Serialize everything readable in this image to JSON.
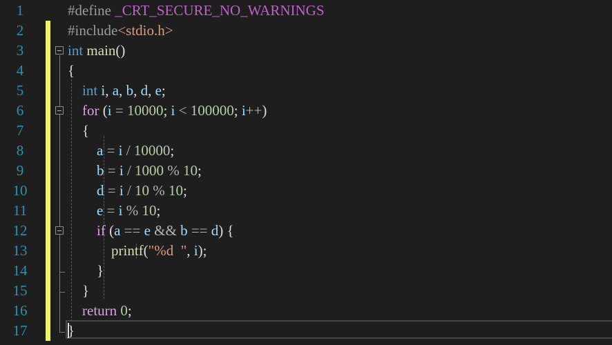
{
  "editor": {
    "line_numbers": [
      "1",
      "2",
      "3",
      "4",
      "5",
      "6",
      "7",
      "8",
      "9",
      "10",
      "11",
      "12",
      "13",
      "14",
      "15",
      "16",
      "17"
    ],
    "lines": [
      [
        {
          "t": "#define ",
          "c": "pp"
        },
        {
          "t": "_CRT_SECURE_NO_WARNINGS",
          "c": "macro"
        }
      ],
      [
        {
          "t": "#include",
          "c": "pp"
        },
        {
          "t": "<stdio.h>",
          "c": "str"
        }
      ],
      [
        {
          "t": "int",
          "c": "kw"
        },
        {
          "t": " ",
          "c": "pl"
        },
        {
          "t": "main",
          "c": "fn"
        },
        {
          "t": "()",
          "c": "pl"
        }
      ],
      [
        {
          "t": "{",
          "c": "pl"
        }
      ],
      [
        {
          "t": "    ",
          "c": "pl"
        },
        {
          "t": "int",
          "c": "kw"
        },
        {
          "t": " ",
          "c": "pl"
        },
        {
          "t": "i",
          "c": "var"
        },
        {
          "t": ", ",
          "c": "pl"
        },
        {
          "t": "a",
          "c": "var"
        },
        {
          "t": ", ",
          "c": "pl"
        },
        {
          "t": "b",
          "c": "var"
        },
        {
          "t": ", ",
          "c": "pl"
        },
        {
          "t": "d",
          "c": "var"
        },
        {
          "t": ", ",
          "c": "pl"
        },
        {
          "t": "e",
          "c": "var"
        },
        {
          "t": ";",
          "c": "pl"
        }
      ],
      [
        {
          "t": "    ",
          "c": "pl"
        },
        {
          "t": "for",
          "c": "kw2"
        },
        {
          "t": " (",
          "c": "pl"
        },
        {
          "t": "i",
          "c": "var"
        },
        {
          "t": " = ",
          "c": "op"
        },
        {
          "t": "10000",
          "c": "num"
        },
        {
          "t": "; ",
          "c": "pl"
        },
        {
          "t": "i",
          "c": "var"
        },
        {
          "t": " < ",
          "c": "op"
        },
        {
          "t": "100000",
          "c": "num"
        },
        {
          "t": "; ",
          "c": "pl"
        },
        {
          "t": "i",
          "c": "var"
        },
        {
          "t": "++",
          "c": "op"
        },
        {
          "t": ")",
          "c": "pl"
        }
      ],
      [
        {
          "t": "    ",
          "c": "pl"
        },
        {
          "t": "{",
          "c": "pl"
        }
      ],
      [
        {
          "t": "        ",
          "c": "pl"
        },
        {
          "t": "a",
          "c": "var"
        },
        {
          "t": " = ",
          "c": "op"
        },
        {
          "t": "i",
          "c": "var"
        },
        {
          "t": " / ",
          "c": "op"
        },
        {
          "t": "10000",
          "c": "num"
        },
        {
          "t": ";",
          "c": "pl"
        }
      ],
      [
        {
          "t": "        ",
          "c": "pl"
        },
        {
          "t": "b",
          "c": "var"
        },
        {
          "t": " = ",
          "c": "op"
        },
        {
          "t": "i",
          "c": "var"
        },
        {
          "t": " / ",
          "c": "op"
        },
        {
          "t": "1000",
          "c": "num"
        },
        {
          "t": " % ",
          "c": "op"
        },
        {
          "t": "10",
          "c": "num"
        },
        {
          "t": ";",
          "c": "pl"
        }
      ],
      [
        {
          "t": "        ",
          "c": "pl"
        },
        {
          "t": "d",
          "c": "var"
        },
        {
          "t": " = ",
          "c": "op"
        },
        {
          "t": "i",
          "c": "var"
        },
        {
          "t": " / ",
          "c": "op"
        },
        {
          "t": "10",
          "c": "num"
        },
        {
          "t": " % ",
          "c": "op"
        },
        {
          "t": "10",
          "c": "num"
        },
        {
          "t": ";",
          "c": "pl"
        }
      ],
      [
        {
          "t": "        ",
          "c": "pl"
        },
        {
          "t": "e",
          "c": "var"
        },
        {
          "t": " = ",
          "c": "op"
        },
        {
          "t": "i",
          "c": "var"
        },
        {
          "t": " % ",
          "c": "op"
        },
        {
          "t": "10",
          "c": "num"
        },
        {
          "t": ";",
          "c": "pl"
        }
      ],
      [
        {
          "t": "        ",
          "c": "pl"
        },
        {
          "t": "if",
          "c": "kw2"
        },
        {
          "t": " (",
          "c": "pl"
        },
        {
          "t": "a",
          "c": "var"
        },
        {
          "t": " == ",
          "c": "op"
        },
        {
          "t": "e",
          "c": "var"
        },
        {
          "t": " && ",
          "c": "op"
        },
        {
          "t": "b",
          "c": "var"
        },
        {
          "t": " == ",
          "c": "op"
        },
        {
          "t": "d",
          "c": "var"
        },
        {
          "t": ") {",
          "c": "pl"
        }
      ],
      [
        {
          "t": "            ",
          "c": "pl"
        },
        {
          "t": "printf",
          "c": "fn"
        },
        {
          "t": "(",
          "c": "pl"
        },
        {
          "t": "\"%d  \"",
          "c": "str"
        },
        {
          "t": ", ",
          "c": "pl"
        },
        {
          "t": "i",
          "c": "var"
        },
        {
          "t": ");",
          "c": "pl"
        }
      ],
      [
        {
          "t": "        ",
          "c": "pl"
        },
        {
          "t": "}",
          "c": "pl"
        }
      ],
      [
        {
          "t": "    ",
          "c": "pl"
        },
        {
          "t": "}",
          "c": "pl"
        }
      ],
      [
        {
          "t": "    ",
          "c": "pl"
        },
        {
          "t": "return",
          "c": "kw2"
        },
        {
          "t": " ",
          "c": "pl"
        },
        {
          "t": "0",
          "c": "num"
        },
        {
          "t": ";",
          "c": "pl"
        }
      ],
      [
        {
          "t": "}",
          "c": "pl"
        }
      ]
    ],
    "colors": {
      "background": "#1e1e1e",
      "line_number": "#2b91af",
      "change_bar": "#eef26f",
      "keyword": "#569cd6",
      "control_keyword": "#d8a0df",
      "string": "#d69d85",
      "number": "#b5cea8",
      "variable": "#9cdcfe",
      "function": "#dcdcaa"
    }
  }
}
